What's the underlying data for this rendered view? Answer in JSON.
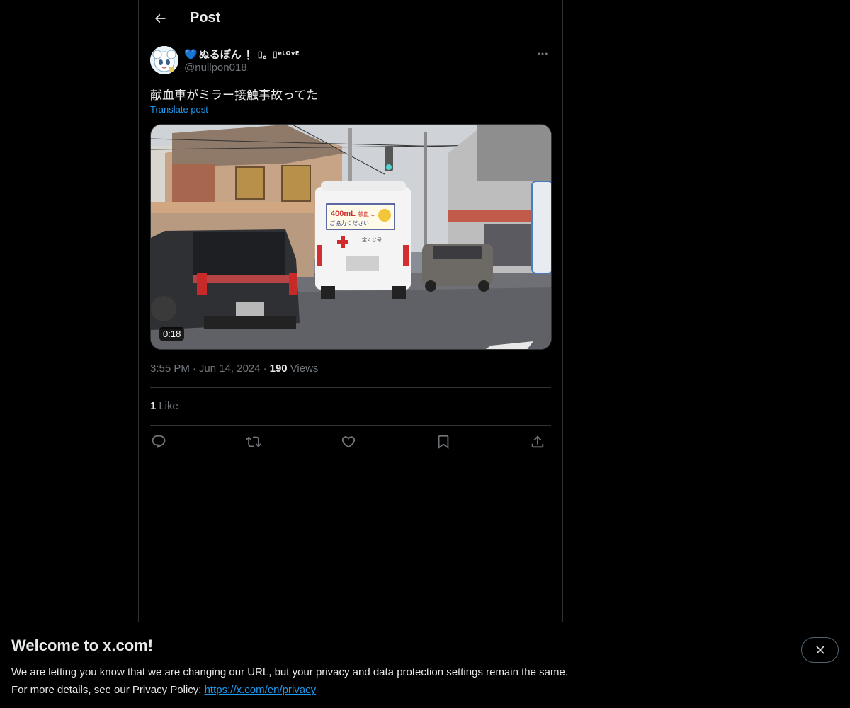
{
  "header": {
    "title": "Post"
  },
  "author": {
    "display_name_heart": "💙",
    "display_name_text": "ぬるぽん",
    "display_name_suffix": "❕ ⌷。⌷ᵉᴸᴼᵛᴱ",
    "handle": "@nullpon018"
  },
  "post": {
    "text": "献血車がミラー接触事故ってた",
    "translate_label": "Translate post",
    "video_duration": "0:18",
    "video_sign": {
      "line1_a": "400mL",
      "line1_b": "献血に",
      "line2": "ご協力ください!",
      "logo": "宝くじ号"
    },
    "time": "3:55 PM",
    "date": "Jun 14, 2024",
    "views_count": "190",
    "views_label": "Views",
    "likes_count": "1",
    "likes_label": "Like"
  },
  "actions": {
    "reply_icon": "reply-icon",
    "repost_icon": "repost-icon",
    "like_icon": "heart-icon",
    "bookmark_icon": "bookmark-icon",
    "share_icon": "share-icon"
  },
  "banner": {
    "title": "Welcome to x.com!",
    "line1": "We are letting you know that we are changing our URL, but your privacy and data protection settings remain the same.",
    "line2_prefix": "For more details, see our Privacy Policy: ",
    "link": "https://x.com/en/privacy"
  },
  "colors": {
    "background": "#000000",
    "text": "#e7e9ea",
    "muted": "#71767b",
    "accent": "#1d9bf0",
    "border": "#2f3336"
  }
}
